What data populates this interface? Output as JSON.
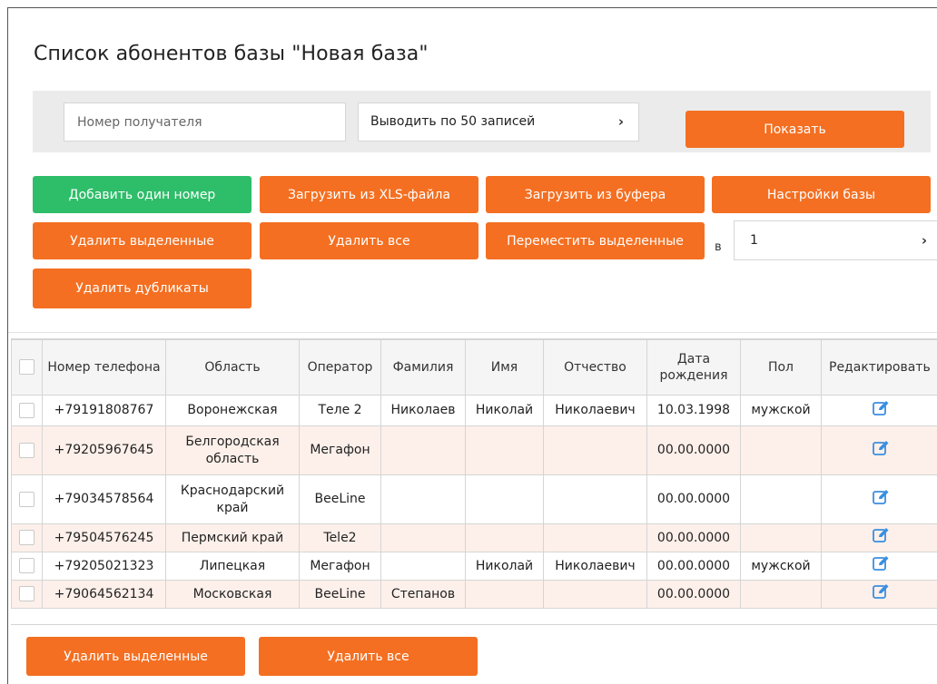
{
  "page": {
    "title": "Список абонентов базы \"Новая база\""
  },
  "filter": {
    "recipient_placeholder": "Номер получателя",
    "per_page_selected": "Выводить по 50 записей",
    "show_label": "Показать"
  },
  "actions": {
    "add_one": "Добавить один номер",
    "upload_xls": "Загрузить из XLS-файла",
    "upload_buffer": "Загрузить из буфера",
    "base_settings": "Настройки базы",
    "delete_selected": "Удалить выделенные",
    "delete_all": "Удалить все",
    "move_selected": "Переместить выделенные",
    "move_in_label": "в",
    "move_target_value": "1",
    "delete_duplicates": "Удалить дубликаты"
  },
  "table": {
    "headers": {
      "phone": "Номер телефона",
      "region": "Область",
      "operator": "Оператор",
      "surname": "Фамилия",
      "name": "Имя",
      "patronymic": "Отчество",
      "birthdate": "Дата рождения",
      "gender": "Пол",
      "edit": "Редактировать"
    },
    "rows": [
      {
        "phone": "+79191808767",
        "region": "Воронежская",
        "operator": "Теле 2",
        "surname": "Николаев",
        "name": "Николай",
        "patronymic": "Николаевич",
        "birthdate": "10.03.1998",
        "gender": "мужской"
      },
      {
        "phone": "+79205967645",
        "region": "Белгородская область",
        "operator": "Мегафон",
        "surname": "",
        "name": "",
        "patronymic": "",
        "birthdate": "00.00.0000",
        "gender": ""
      },
      {
        "phone": "+79034578564",
        "region": "Краснодарский край",
        "operator": "BeeLine",
        "surname": "",
        "name": "",
        "patronymic": "",
        "birthdate": "00.00.0000",
        "gender": ""
      },
      {
        "phone": "+79504576245",
        "region": "Пермский край",
        "operator": "Tele2",
        "surname": "",
        "name": "",
        "patronymic": "",
        "birthdate": "00.00.0000",
        "gender": ""
      },
      {
        "phone": "+79205021323",
        "region": "Липецкая",
        "operator": "Мегафон",
        "surname": "",
        "name": "Николай",
        "patronymic": "Николаевич",
        "birthdate": "00.00.0000",
        "gender": "мужской"
      },
      {
        "phone": "+79064562134",
        "region": "Московская",
        "operator": "BeeLine",
        "surname": "Степанов",
        "name": "",
        "patronymic": "",
        "birthdate": "00.00.0000",
        "gender": ""
      }
    ]
  },
  "bottom": {
    "delete_selected": "Удалить выделенные",
    "delete_all": "Удалить все"
  },
  "colors": {
    "accent_orange": "#f46f21",
    "accent_green": "#2ebd69",
    "row_highlight": "#fdf0ea",
    "edit_icon_blue": "#3a8ee0"
  },
  "icons": {
    "chevron": "chevron-right-icon",
    "edit": "edit-pencil-icon",
    "checkbox": "checkbox-icon"
  }
}
